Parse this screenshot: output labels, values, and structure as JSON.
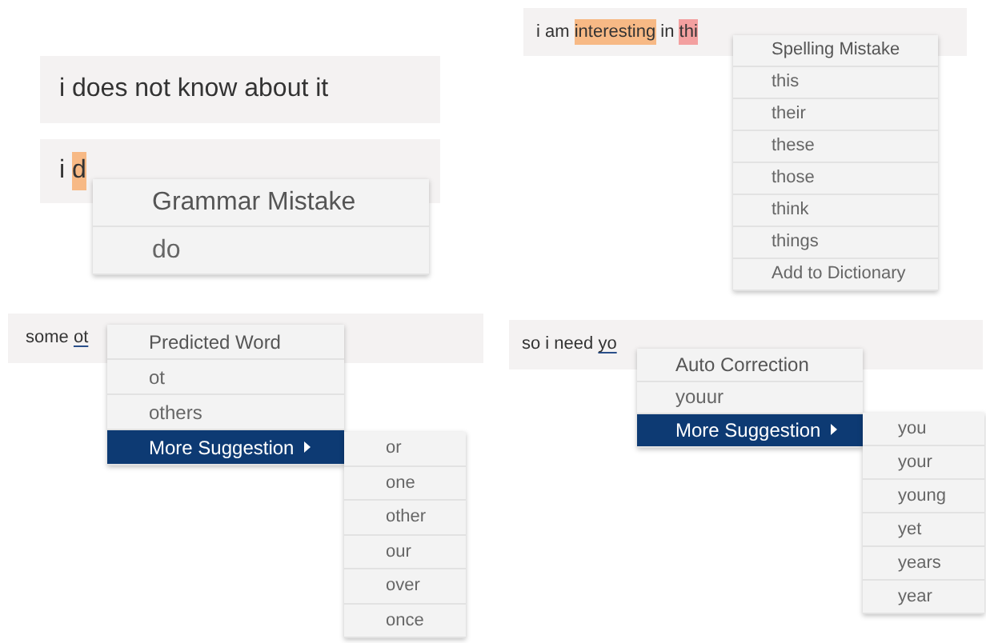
{
  "panels": [
    {
      "fields": [
        {
          "segments": [
            {
              "text": "i does not know about it",
              "kind": "plain"
            }
          ]
        },
        {
          "segments": [
            {
              "text": "i ",
              "kind": "plain"
            },
            {
              "text": "d",
              "kind": "grammar"
            }
          ]
        }
      ],
      "menu": {
        "items": [
          {
            "label": "Grammar Mistake",
            "kind": "header",
            "selected": false
          },
          {
            "label": "do",
            "kind": "item",
            "selected": false
          }
        ]
      }
    },
    {
      "fields": [
        {
          "segments": [
            {
              "text": "i am ",
              "kind": "plain"
            },
            {
              "text": "interesting",
              "kind": "grammar"
            },
            {
              "text": " in ",
              "kind": "plain"
            },
            {
              "text": "thi",
              "kind": "spelling"
            }
          ]
        }
      ],
      "menu": {
        "items": [
          {
            "label": "Spelling Mistake",
            "kind": "header",
            "selected": false
          },
          {
            "label": "this",
            "kind": "item",
            "selected": false
          },
          {
            "label": "their",
            "kind": "item",
            "selected": false
          },
          {
            "label": "these",
            "kind": "item",
            "selected": false
          },
          {
            "label": "those",
            "kind": "item",
            "selected": false
          },
          {
            "label": "think",
            "kind": "item",
            "selected": false
          },
          {
            "label": "things",
            "kind": "item",
            "selected": false
          },
          {
            "label": "Add to Dictionary",
            "kind": "item",
            "selected": false
          }
        ]
      }
    },
    {
      "fields": [
        {
          "segments": [
            {
              "text": "some ",
              "kind": "plain"
            },
            {
              "text": "ot",
              "kind": "underline"
            }
          ]
        }
      ],
      "menu": {
        "items": [
          {
            "label": "Predicted Word",
            "kind": "header",
            "selected": false
          },
          {
            "label": "ot",
            "kind": "item",
            "selected": false
          },
          {
            "label": "others",
            "kind": "item",
            "selected": false
          },
          {
            "label": "More Suggestion",
            "kind": "submenu",
            "selected": true
          }
        ]
      },
      "submenu": {
        "items": [
          {
            "label": "or"
          },
          {
            "label": "one"
          },
          {
            "label": "other"
          },
          {
            "label": "our"
          },
          {
            "label": "over"
          },
          {
            "label": "once"
          }
        ]
      }
    },
    {
      "fields": [
        {
          "segments": [
            {
              "text": "so i need ",
              "kind": "plain"
            },
            {
              "text": "yo",
              "kind": "underline"
            }
          ]
        }
      ],
      "menu": {
        "items": [
          {
            "label": "Auto Correction",
            "kind": "header",
            "selected": false
          },
          {
            "label": "youur",
            "kind": "item",
            "selected": false
          },
          {
            "label": "More Suggestion",
            "kind": "submenu",
            "selected": true
          }
        ]
      },
      "submenu": {
        "items": [
          {
            "label": "you"
          },
          {
            "label": "your"
          },
          {
            "label": "young"
          },
          {
            "label": "yet"
          },
          {
            "label": "years"
          },
          {
            "label": "year"
          }
        ]
      }
    }
  ]
}
